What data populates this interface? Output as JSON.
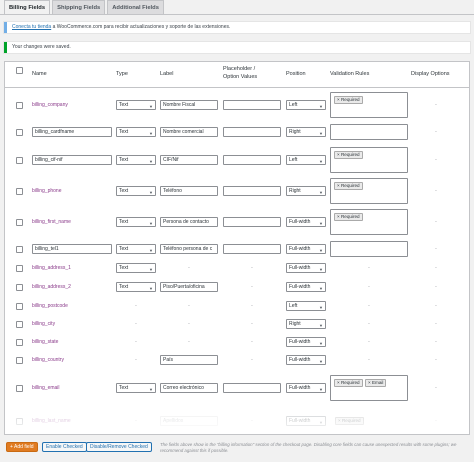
{
  "tabs": [
    {
      "label": "Billing Fields",
      "active": true
    },
    {
      "label": "Shipping Fields",
      "active": false
    },
    {
      "label": "Additional Fields",
      "active": false
    }
  ],
  "notice_info": {
    "link": "Conecta tu tienda",
    "text": " a WooCommerce.com para recibir actualizaciones y soporte de las extensiones."
  },
  "notice_success": {
    "text": "Your changes were saved."
  },
  "columns": {
    "name": "Name",
    "type": "Type",
    "label": "Label",
    "placeholder": "Placeholder /",
    "placeholder2": "Option Values",
    "position": "Position",
    "validation": "Validation Rules",
    "display": "Display Options"
  },
  "rows": [
    {
      "name": "billing_company",
      "editable": false,
      "type": "Text",
      "label": "Nombre Fiscal",
      "placeholder": "",
      "position": "Left",
      "tags": [
        "Required"
      ],
      "vbox_tall": true,
      "display": "-"
    },
    {
      "name": "billing_cardfname",
      "editable": true,
      "type": "Text",
      "label": "Nombre comercial",
      "placeholder": "",
      "position": "Right",
      "tags": [],
      "vbox_tall": false,
      "display": "-"
    },
    {
      "name": "billing_cif-nif",
      "editable": true,
      "type": "Text",
      "label": "CIF/Nif",
      "placeholder": "",
      "position": "Left",
      "tags": [
        "Required"
      ],
      "vbox_tall": true,
      "display": "-"
    },
    {
      "name": "billing_phone",
      "editable": false,
      "type": "Text",
      "label": "Teléfono",
      "placeholder": "",
      "position": "Right",
      "tags": [
        "Required"
      ],
      "vbox_tall": true,
      "display": "-"
    },
    {
      "name": "billing_first_name",
      "editable": false,
      "type": "Text",
      "label": "Persona de contacto",
      "placeholder": "",
      "position": "Full-width",
      "tags": [
        "Required"
      ],
      "vbox_tall": true,
      "display": "-"
    },
    {
      "name": "billing_tel1",
      "editable": true,
      "type": "Text",
      "label": "Teléfono persona de c",
      "placeholder": "",
      "position": "Full-width",
      "tags": [],
      "vbox_tall": false,
      "display": "-"
    },
    {
      "name": "billing_address_1",
      "editable": false,
      "type": "Text",
      "label": "-",
      "placeholder": "-",
      "position": "Full-width",
      "tags": [],
      "plain": true,
      "display": "-"
    },
    {
      "name": "billing_address_2",
      "editable": false,
      "type": "Text",
      "label": "Piso/Puerta/oficina",
      "placeholder": "-",
      "position": "Full-width",
      "tags": [],
      "plain": true,
      "display": "-"
    },
    {
      "name": "billing_postcode",
      "editable": false,
      "type": "-",
      "label": "-",
      "placeholder": "-",
      "position": "Left",
      "tags": [],
      "plain": true,
      "display": "-"
    },
    {
      "name": "billing_city",
      "editable": false,
      "type": "-",
      "label": "-",
      "placeholder": "-",
      "position": "Right",
      "tags": [],
      "plain": true,
      "display": "-"
    },
    {
      "name": "billing_state",
      "editable": false,
      "type": "-",
      "label": "-",
      "placeholder": "-",
      "position": "Full-width",
      "tags": [],
      "plain": true,
      "display": "-"
    },
    {
      "name": "billing_country",
      "editable": false,
      "type": "-",
      "label": "País",
      "placeholder": "-",
      "position": "Full-width",
      "tags": [],
      "plain": true,
      "display": "-"
    },
    {
      "name": "billing_email",
      "editable": false,
      "type": "Text",
      "label": "Correo electrónico",
      "placeholder": "",
      "position": "Full-width",
      "tags": [
        "Required",
        "Email"
      ],
      "vbox_tall": true,
      "display": "-"
    },
    {
      "name": "billing_last_name",
      "editable": false,
      "type": "-",
      "label": "Apellidos",
      "placeholder": "-",
      "position": "Full-width",
      "tags": [
        "Required"
      ],
      "plain": true,
      "faded": true,
      "display": "-"
    }
  ],
  "footer": {
    "add_field": "+ Add field",
    "enable_checked": "Enable Checked",
    "disable_remove": "Disable/Remove Checked",
    "note": "The fields above show in the \"billing information\" section of the checkout page. Disabling core fields can cause unexpected results with some plugins; we recommend against this if possible."
  }
}
